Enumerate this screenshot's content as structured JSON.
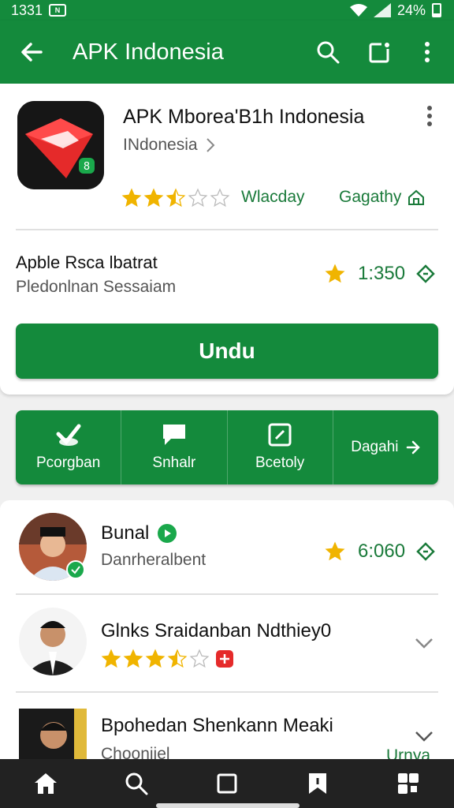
{
  "status": {
    "time": "1331",
    "notif_label": "N",
    "battery_text": "24%",
    "battery_level": 0.24
  },
  "appbar": {
    "title": "APK Indonesia",
    "icons": [
      "back-arrow-icon",
      "search-icon",
      "share-window-icon",
      "more-vert-icon"
    ]
  },
  "app": {
    "name": "APK Mborea'B1h Indonesia",
    "publisher": "INdonesia",
    "rating_stars": 2.5,
    "link1": "Wlacday",
    "link2": "Gagathy",
    "info_title": "Apble Rsca lbatrat",
    "info_sub": "Pledonlnan Sessaiam",
    "info_rating": "1:350",
    "install_label": "Undu"
  },
  "actions": [
    {
      "label": "Pcorgban",
      "icon": "check-hand-icon"
    },
    {
      "label": "Snhalr",
      "icon": "chat-bubble-icon"
    },
    {
      "label": "Bcetoly",
      "icon": "edit-square-icon"
    },
    {
      "label": "Dagahi",
      "icon": "arrow-right-icon"
    }
  ],
  "list": [
    {
      "title": "Bunal",
      "sub": "Danrheralbent",
      "rating": "6:060",
      "badge": "green-play-icon"
    },
    {
      "title": "Glnks Sraidanban Ndthiey0",
      "stars": 3.5,
      "badge": "red-plus-icon"
    },
    {
      "title": "Bpohedan Shenkann Meaki",
      "sub": "Choonijel",
      "extra": "Urnya"
    }
  ],
  "nav": [
    "home-icon",
    "search-icon",
    "square-icon",
    "bookmark-icon",
    "apps-icon"
  ],
  "colors": {
    "primary": "#148a3c",
    "accent_text": "#1a7a3a",
    "star": "#f0b400"
  }
}
